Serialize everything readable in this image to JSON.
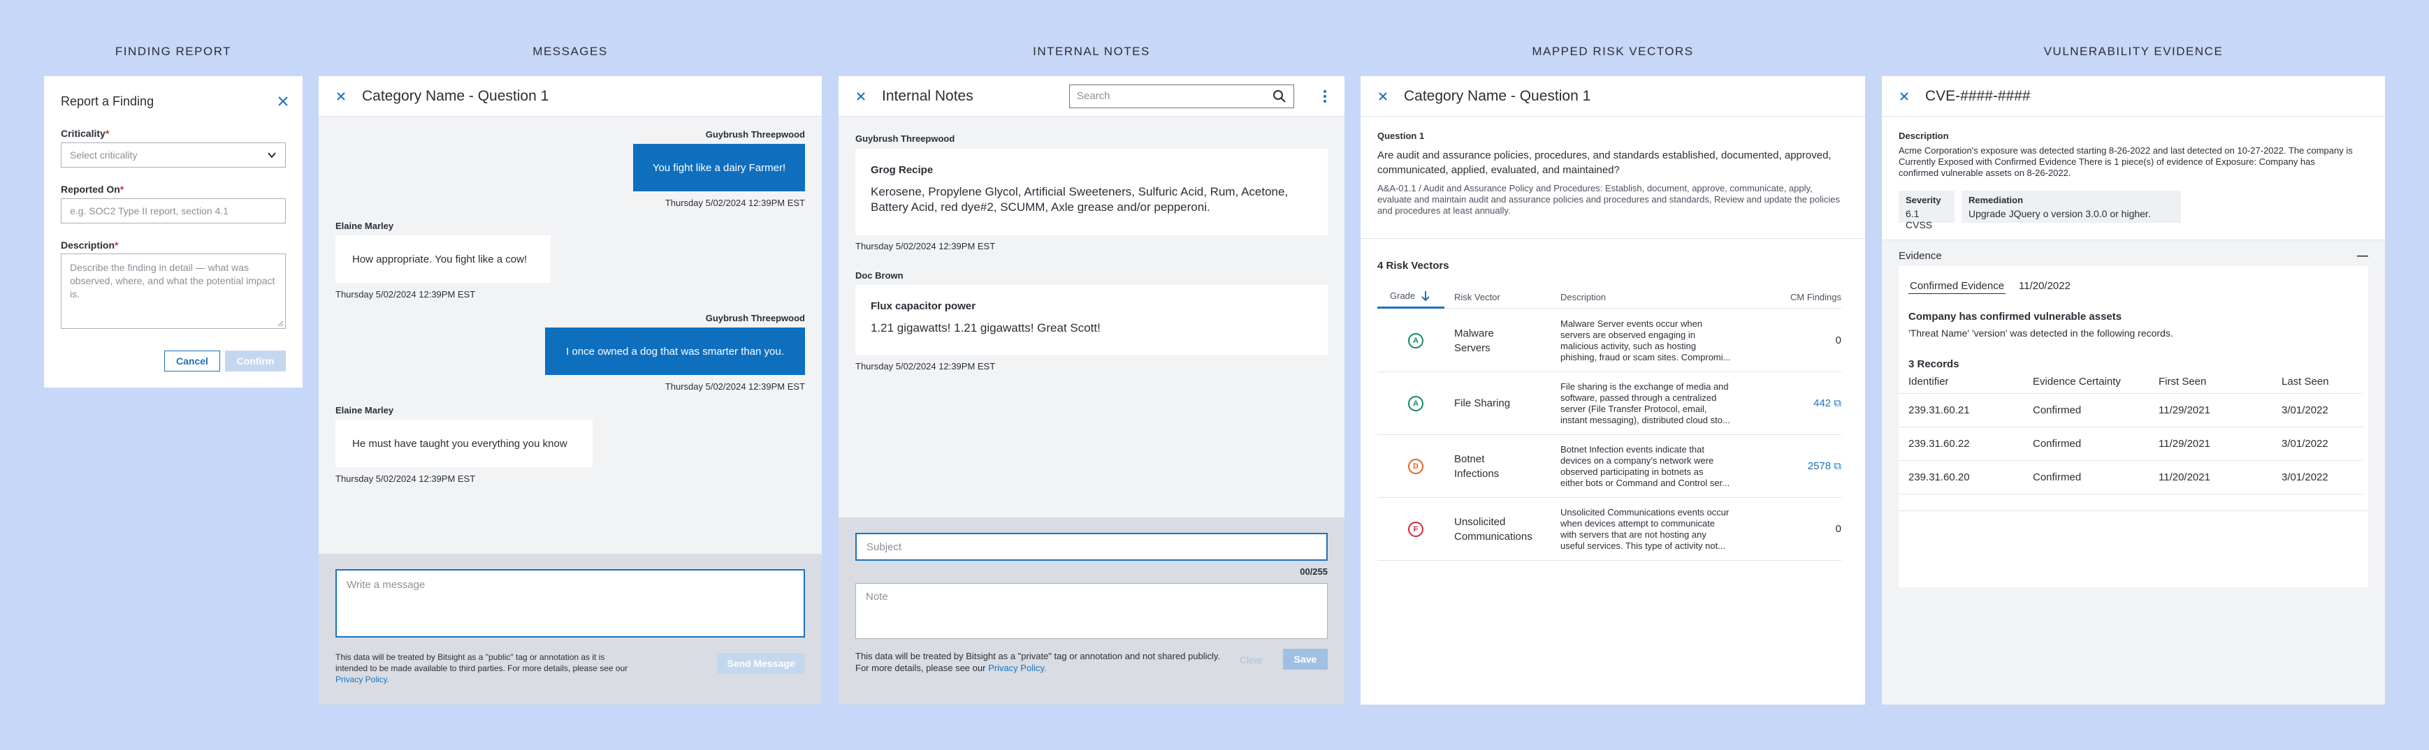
{
  "columns": {
    "finding_report": "FINDING REPORT",
    "messages": "MESSAGES",
    "internal_notes": "INTERNAL NOTES",
    "mapped_risk_vectors": "MAPPED RISK VECTORS",
    "vulnerability_evidence": "VULNERABILITY EVIDENCE"
  },
  "finding": {
    "title": "Report a Finding",
    "criticality_label": "Criticality",
    "criticality_placeholder": "Select criticality",
    "reported_on_label": "Reported On",
    "reported_on_placeholder": "e.g. SOC2 Type II report, section 4.1",
    "description_label": "Description",
    "description_placeholder": "Describe the finding in detail — what was observed, where, and what the potential impact is.",
    "required_mark": "*",
    "cancel": "Cancel",
    "confirm": "Confirm"
  },
  "messages": {
    "header": "Category Name - Question 1",
    "items": [
      {
        "sender": "Guybrush Threepwood",
        "text": "You fight like a dairy Farmer!",
        "time": "Thursday 5/02/2024 12:39PM EST"
      },
      {
        "sender": "Elaine Marley",
        "text": "How appropriate. You fight like a cow!",
        "time": "Thursday 5/02/2024 12:39PM EST"
      },
      {
        "sender": "Guybrush Threepwood",
        "text": "I once owned a dog that was smarter than you.",
        "time": "Thursday 5/02/2024 12:39PM EST"
      },
      {
        "sender": "Elaine Marley",
        "text": "He must have taught you everything you know",
        "time": "Thursday 5/02/2024 12:39PM EST"
      }
    ],
    "input_placeholder": "Write a message",
    "disclaimer": "This data will be treated by Bitsight as a \"public\" tag or annotation as it is intended to be made available to third parties. For more details, please see our",
    "privacy_link": "Privacy Policy.",
    "send": "Send Message"
  },
  "notes": {
    "header": "Internal Notes",
    "search_placeholder": "Search",
    "items": [
      {
        "author": "Guybrush Threepwood",
        "title": "Grog Recipe",
        "body": "Kerosene, Propylene Glycol, Artificial Sweeteners, Sulfuric Acid, Rum, Acetone, Battery Acid, red dye#2, SCUMM, Axle grease and/or pepperoni.",
        "time": "Thursday 5/02/2024 12:39PM EST"
      },
      {
        "author": "Doc Brown",
        "title": "Flux capacitor power",
        "body": "1.21 gigawatts! 1.21 gigawatts! Great Scott!",
        "time": "Thursday 5/02/2024 12:39PM EST"
      }
    ],
    "subject_placeholder": "Subject",
    "counter": "00/255",
    "note_placeholder": "Note",
    "disclaimer_line1": "This data will be treated by Bitsight as a \"private\" tag or annotation and not shared publicly.",
    "disclaimer_line2": "For more details, please see our",
    "privacy_link": "Privacy Policy.",
    "clear": "Clear",
    "save": "Save"
  },
  "risk": {
    "header": "Category Name - Question 1",
    "question_label": "Question 1",
    "question_text": "Are audit and assurance policies, procedures, and standards established, documented, approved, communicated, applied, evaluated, and maintained?",
    "control_text": "A&A-01.1 / Audit and Assurance Policy and Procedures: Establish, document, approve, communicate, apply, evaluate and maintain audit and assurance policies and procedures and standards, Review and update the policies and procedures at least annually.",
    "vectors_title": "4 Risk Vectors",
    "col_grade": "Grade",
    "col_vector": "Risk Vector",
    "col_description": "Description",
    "col_findings": "CM Findings",
    "rows": [
      {
        "grade": "A",
        "vector_l1": "Malware",
        "vector_l2": "Servers",
        "desc": [
          "Malware Server events occur when",
          "servers are observed engaging in",
          "malicious activity, such as hosting",
          "phishing, fraud or scam sites. Compromi..."
        ],
        "findings": "0",
        "link": false
      },
      {
        "grade": "A",
        "vector_l1": "File Sharing",
        "vector_l2": "",
        "desc": [
          "File sharing is the exchange of media and",
          "software, passed through a centralized",
          "server (File Transfer Protocol, email,",
          "instant messaging), distributed cloud sto..."
        ],
        "findings": "442",
        "link": true
      },
      {
        "grade": "D",
        "vector_l1": "Botnet",
        "vector_l2": "Infections",
        "desc": [
          "Botnet Infection events indicate that",
          "devices on a company's network were",
          "observed participating in botnets as",
          "either bots or Command and Control ser..."
        ],
        "findings": "2578",
        "link": true
      },
      {
        "grade": "F",
        "vector_l1": "Unsolicited",
        "vector_l2": "Communications",
        "desc": [
          "Unsolicited Communications events occur",
          "when devices attempt to communicate",
          "with servers that are not hosting any",
          "useful services. This type of activity not..."
        ],
        "findings": "0",
        "link": false
      }
    ]
  },
  "vuln": {
    "header": "CVE-####-####",
    "desc_label": "Description",
    "desc_text": "Acme Corporation's exposure was detected starting 8-26-2022 and last detected on 10-27-2022. The company is Currently Exposed with Confirmed Evidence There is 1 piece(s) of evidence of Exposure: Company has confirmed vulnerable assets on 8-26-2022.",
    "severity_label": "Severity",
    "severity_value": "6.1 CVSS",
    "remediation_label": "Remediation",
    "remediation_value": "Upgrade JQuery o version 3.0.0 or higher.",
    "evidence_label": "Evidence",
    "collapse": "—",
    "confirmed_tag": "Confirmed Evidence",
    "confirmed_date": "11/20/2022",
    "assets_title": "Company has confirmed vulnerable assets",
    "assets_text": "'Threat Name' 'version' was detected in the following records.",
    "records_title": "3 Records",
    "col_identifier": "Identifier",
    "col_certainty": "Evidence Certainty",
    "col_first": "First Seen",
    "col_last": "Last Seen",
    "records": [
      {
        "id": "239.31.60.21",
        "certainty": "Confirmed",
        "first": "11/29/2021",
        "last": "3/01/2022"
      },
      {
        "id": "239.31.60.22",
        "certainty": "Confirmed",
        "first": "11/29/2021",
        "last": "3/01/2022"
      },
      {
        "id": "239.31.60.20",
        "certainty": "Confirmed",
        "first": "11/20/2021",
        "last": "3/01/2022"
      }
    ]
  }
}
